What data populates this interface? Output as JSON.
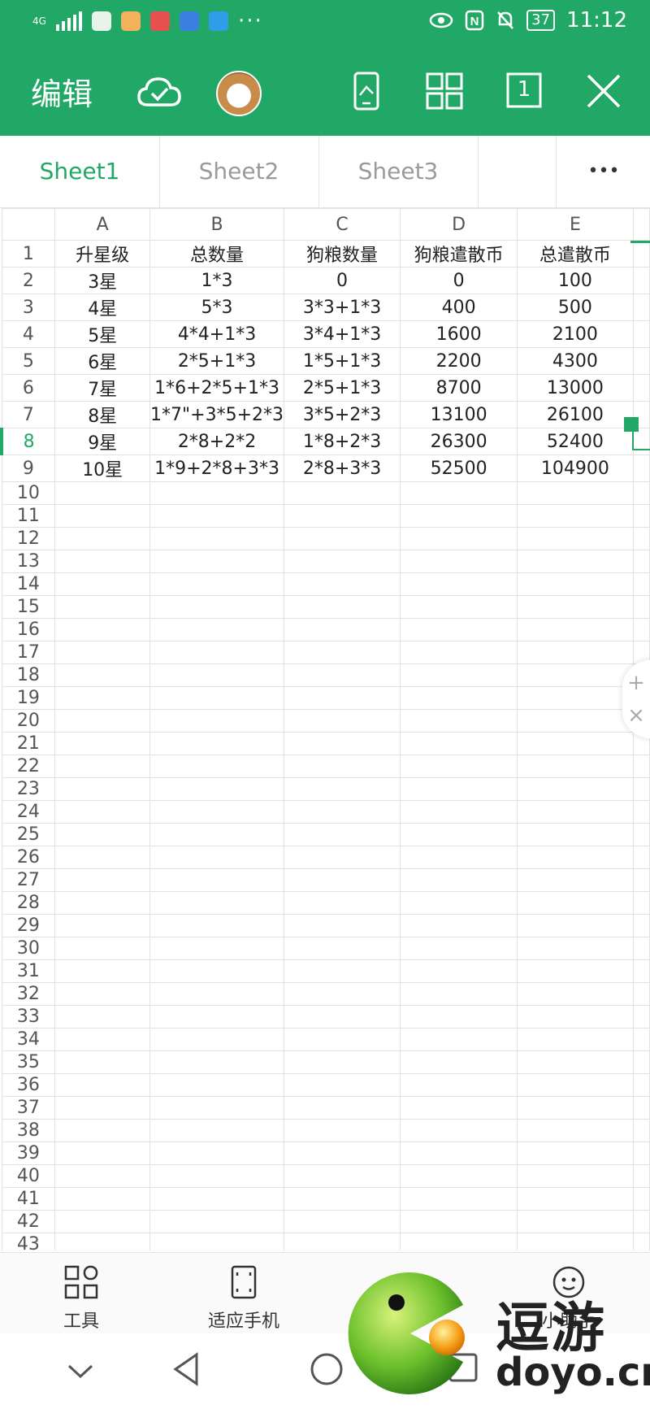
{
  "status": {
    "network": "4G",
    "time": "11:12",
    "battery": "37",
    "more": "···"
  },
  "header": {
    "edit_label": "编辑",
    "page_number": "1"
  },
  "tabs": [
    "Sheet1",
    "Sheet2",
    "Sheet3"
  ],
  "tabs_more": "•••",
  "grid": {
    "columns": [
      "A",
      "B",
      "C",
      "D",
      "E"
    ],
    "rows": [
      [
        "升星级",
        "总数量",
        "狗粮数量",
        "狗粮遣散币",
        "总遣散币"
      ],
      [
        "3星",
        "1*3",
        "0",
        "0",
        "100"
      ],
      [
        "4星",
        "5*3",
        "3*3+1*3",
        "400",
        "500"
      ],
      [
        "5星",
        "4*4+1*3",
        "3*4+1*3",
        "1600",
        "2100"
      ],
      [
        "6星",
        "2*5+1*3",
        "1*5+1*3",
        "2200",
        "4300"
      ],
      [
        "7星",
        "1*6+2*5+1*3",
        "2*5+1*3",
        "8700",
        "13000"
      ],
      [
        "8星",
        "1*7\"+3*5+2*3",
        "3*5+2*3",
        "13100",
        "26100"
      ],
      [
        "9星",
        "2*8+2*2",
        "1*8+2*3",
        "26300",
        "52400"
      ],
      [
        "10星",
        "1*9+2*8+3*3",
        "2*8+3*3",
        "52500",
        "104900"
      ]
    ],
    "row_count": 43,
    "selected_row": 8
  },
  "float_panel": {
    "plus": "+",
    "close": "×"
  },
  "toolbar": {
    "tools_label": "工具",
    "fit_label": "适应手机",
    "helper_label": "小助手"
  },
  "watermark": {
    "brand_cn": "逗游",
    "brand_url": "doyo.cn"
  },
  "colors": {
    "accent": "#22a866"
  }
}
